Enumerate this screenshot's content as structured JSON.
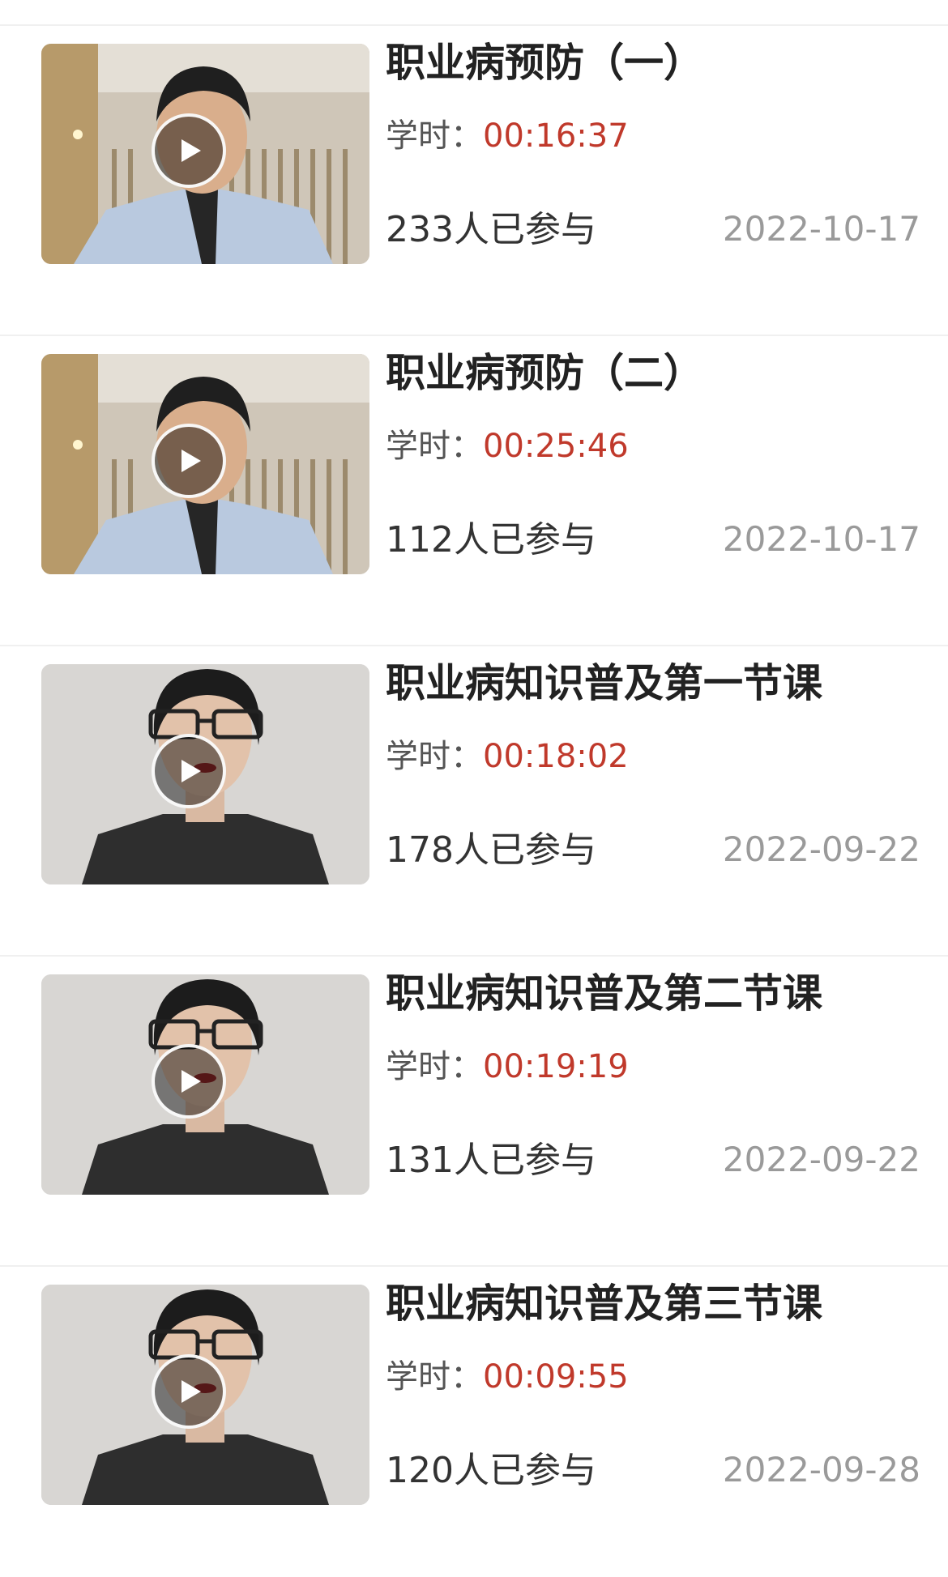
{
  "courses": [
    {
      "title": "职业病预防（一）",
      "hours_label": "学时：",
      "hours_value": "00:16:37",
      "participants": "233人已参与",
      "date": "2022-10-17",
      "thumbnail": "male-lecturer-video"
    },
    {
      "title": "职业病预防（二）",
      "hours_label": "学时：",
      "hours_value": "00:25:46",
      "participants": "112人已参与",
      "date": "2022-10-17",
      "thumbnail": "male-lecturer-video"
    },
    {
      "title": "职业病知识普及第一节课",
      "hours_label": "学时：",
      "hours_value": "00:18:02",
      "participants": "178人已参与",
      "date": "2022-09-22",
      "thumbnail": "female-lecturer-video"
    },
    {
      "title": "职业病知识普及第二节课",
      "hours_label": "学时：",
      "hours_value": "00:19:19",
      "participants": "131人已参与",
      "date": "2022-09-22",
      "thumbnail": "female-lecturer-video"
    },
    {
      "title": "职业病知识普及第三节课",
      "hours_label": "学时：",
      "hours_value": "00:09:55",
      "participants": "120人已参与",
      "date": "2022-09-28",
      "thumbnail": "female-lecturer-video"
    }
  ],
  "colors": {
    "hours_value": "#c0392b",
    "date": "#9a9a9a",
    "title": "#222222",
    "divider": "#f0f0f0"
  },
  "icons": {
    "play": "play-icon"
  }
}
